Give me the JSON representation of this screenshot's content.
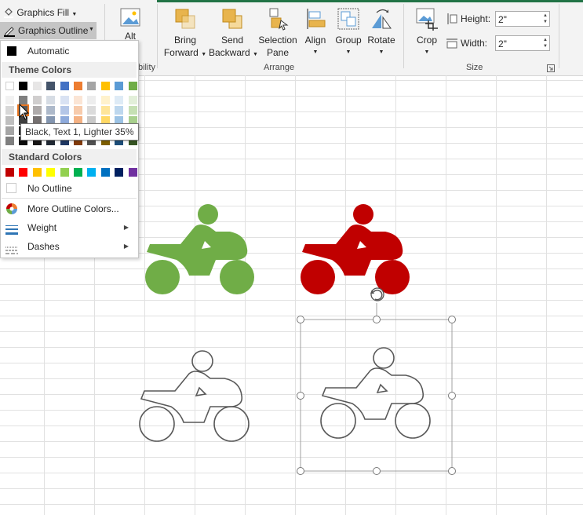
{
  "ribbon": {
    "graphics_fill": "Graphics Fill",
    "graphics_outline": "Graphics Outline",
    "alt_text_partial": "Alt",
    "accessibility_partial": "bility",
    "bring_forward_line1": "Bring",
    "bring_forward_line2": "Forward",
    "send_backward_line1": "Send",
    "send_backward_line2": "Backward",
    "selection_pane_line1": "Selection",
    "selection_pane_line2": "Pane",
    "align": "Align",
    "group": "Group",
    "rotate": "Rotate",
    "arrange_label": "Arrange",
    "crop": "Crop",
    "height_label": "Height:",
    "height_value": "2\"",
    "width_label": "Width:",
    "width_value": "2\"",
    "size_label": "Size"
  },
  "menu": {
    "automatic": "Automatic",
    "theme_colors": "Theme Colors",
    "standard_colors": "Standard Colors",
    "no_outline": "No Outline",
    "more_colors": "More Outline Colors...",
    "weight": "Weight",
    "dashes": "Dashes",
    "tooltip": "Black, Text 1, Lighter 35%",
    "theme_base": [
      "#ffffff",
      "#000000",
      "#e7e6e6",
      "#44546a",
      "#4472c4",
      "#ed7d31",
      "#a5a5a5",
      "#ffc000",
      "#5b9bd5",
      "#70ad47"
    ],
    "theme_shades": [
      [
        "#f2f2f2",
        "#7f7f7f",
        "#d0cece",
        "#d6dce4",
        "#d9e2f3",
        "#fbe5d5",
        "#ededed",
        "#fff2cc",
        "#deebf6",
        "#e2efd9"
      ],
      [
        "#d8d8d8",
        "#595959",
        "#aeaaaa",
        "#adb9ca",
        "#b4c6e7",
        "#f7cbac",
        "#dbdbdb",
        "#fee599",
        "#bdd7ee",
        "#c5e0b3"
      ],
      [
        "#bfbfbf",
        "#3f3f3f",
        "#757070",
        "#8496b0",
        "#8eaadb",
        "#f4b183",
        "#c9c9c9",
        "#ffd965",
        "#9cc3e5",
        "#a8d08d"
      ],
      [
        "#a5a5a5",
        "#262626",
        "#3a3838",
        "#323f4f",
        "#2f5496",
        "#c55a11",
        "#7b7b7b",
        "#bf9000",
        "#2e75b5",
        "#538135"
      ],
      [
        "#7f7f7f",
        "#0c0c0c",
        "#171616",
        "#222a35",
        "#1f3864",
        "#833c0b",
        "#525252",
        "#7f6000",
        "#1e4e79",
        "#375623"
      ]
    ],
    "standard": [
      "#c00000",
      "#ff0000",
      "#ffc000",
      "#ffff00",
      "#92d050",
      "#00b050",
      "#00b0f0",
      "#0070c0",
      "#002060",
      "#7030a0"
    ]
  },
  "colors": {
    "green_bike": "#70ad47",
    "red_bike": "#c00000",
    "outline_bike": "#595959"
  }
}
